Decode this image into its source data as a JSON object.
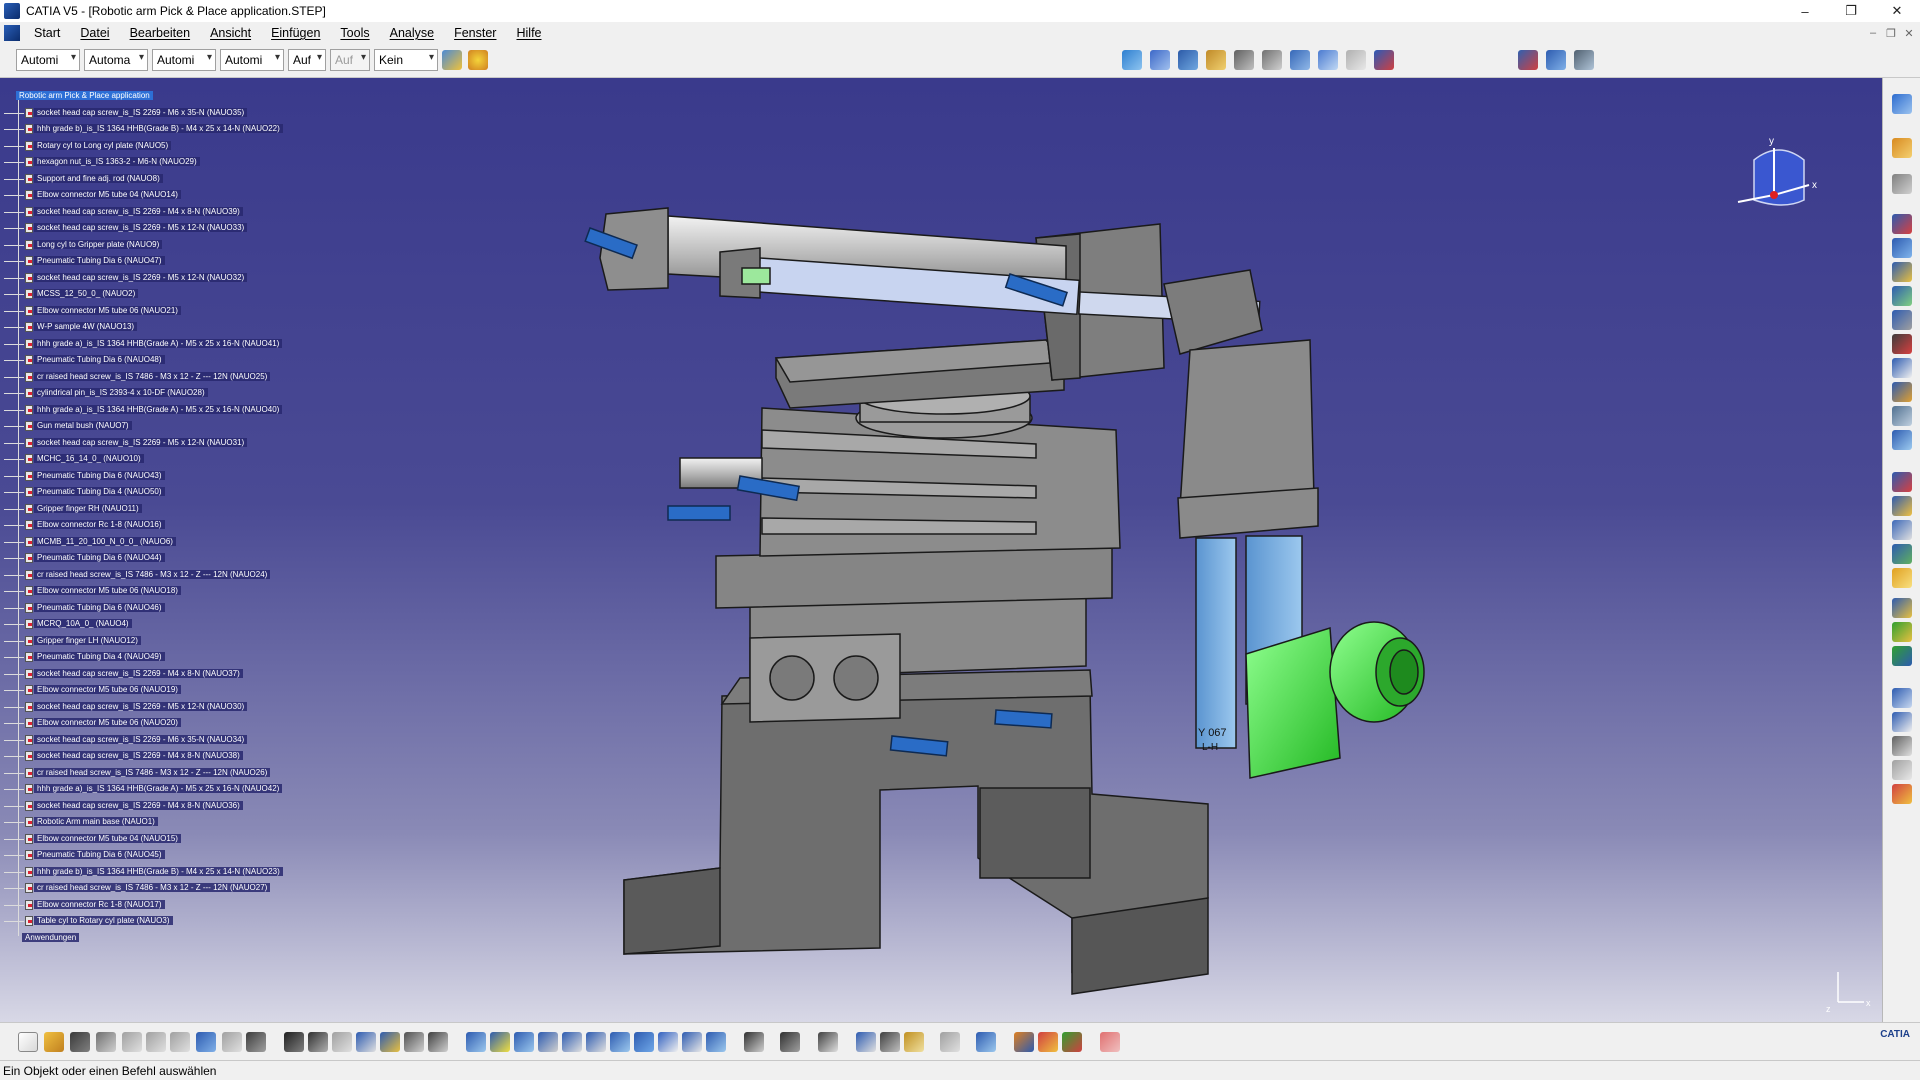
{
  "window": {
    "title": "CATIA V5 - [Robotic arm Pick & Place application.STEP]",
    "controls": [
      "–",
      "❐",
      "✕"
    ]
  },
  "menu": {
    "items": [
      "Start",
      "Datei",
      "Bearbeiten",
      "Ansicht",
      "Einfügen",
      "Tools",
      "Analyse",
      "Fenster",
      "Hilfe"
    ],
    "mdi_controls": [
      "–",
      "❐",
      "✕"
    ]
  },
  "toolbar": {
    "combos": [
      {
        "value": "Automi",
        "disabled": false
      },
      {
        "value": "Automa",
        "disabled": false
      },
      {
        "value": "Automi",
        "disabled": false
      },
      {
        "value": "Automi",
        "disabled": false
      },
      {
        "value": "Auf",
        "disabled": false
      },
      {
        "value": "Auf",
        "disabled": true
      },
      {
        "value": "Kein",
        "disabled": false
      }
    ]
  },
  "tree": {
    "root": "Robotic arm Pick & Place application",
    "nodes": [
      "socket head cap screw_is_IS 2269 - M6 x 35-N (NAUO35)",
      "hhh grade b)_is_IS 1364 HHB(Grade B) - M4 x 25 x 14-N (NAUO22)",
      "Rotary cyl to Long cyl plate (NAUO5)",
      "hexagon nut_is_IS 1363-2 - M6-N (NAUO29)",
      "Support and fine adj. rod (NAUO8)",
      "Elbow connector M5 tube 04 (NAUO14)",
      "socket head cap screw_is_IS 2269 - M4 x 8-N (NAUO39)",
      "socket head cap screw_is_IS 2269 - M5 x 12-N (NAUO33)",
      "Long cyl to Gripper plate (NAUO9)",
      "Pneumatic Tubing Dia 6 (NAUO47)",
      "socket head cap screw_is_IS 2269 - M5 x 12-N (NAUO32)",
      "MCSS_12_50_0_ (NAUO2)",
      "Elbow connector M5 tube 06 (NAUO21)",
      "W-P sample 4W (NAUO13)",
      "hhh grade a)_is_IS 1364 HHB(Grade A) - M5 x 25 x 16-N (NAUO41)",
      "Pneumatic Tubing Dia 6 (NAUO48)",
      "cr raised head screw_is_IS 7486 - M3 x 12 - Z --- 12N (NAUO25)",
      "cylindrical pin_is_IS 2393-4 x 10-DF (NAUO28)",
      "hhh grade a)_is_IS 1364 HHB(Grade A) - M5 x 25 x 16-N (NAUO40)",
      "Gun metal bush (NAUO7)",
      "socket head cap screw_is_IS 2269 - M5 x 12-N (NAUO31)",
      "MCHC_16_14_0_ (NAUO10)",
      "Pneumatic Tubing Dia 6 (NAUO43)",
      "Pneumatic Tubing Dia 4 (NAUO50)",
      "Gripper finger RH (NAUO11)",
      "Elbow connector Rc 1-8 (NAUO16)",
      "MCMB_11_20_100_N_0_0_ (NAUO6)",
      "Pneumatic Tubing Dia 6 (NAUO44)",
      "cr raised head screw_is_IS 7486 - M3 x 12 - Z --- 12N (NAUO24)",
      "Elbow connector M5 tube 06 (NAUO18)",
      "Pneumatic Tubing Dia 6 (NAUO46)",
      "MCRQ_10A_0_ (NAUO4)",
      "Gripper finger LH (NAUO12)",
      "Pneumatic Tubing Dia 4 (NAUO49)",
      "socket head cap screw_is_IS 2269 - M4 x 8-N (NAUO37)",
      "Elbow connector M5 tube 06 (NAUO19)",
      "socket head cap screw_is_IS 2269 - M5 x 12-N (NAUO30)",
      "Elbow connector M5 tube 06 (NAUO20)",
      "socket head cap screw_is_IS 2269 - M6 x 35-N (NAUO34)",
      "socket head cap screw_is_IS 2269 - M4 x 8-N (NAUO38)",
      "cr raised head screw_is_IS 7486 - M3 x 12 - Z --- 12N (NAUO26)",
      "hhh grade a)_is_IS 1364 HHB(Grade A) - M5 x 25 x 16-N (NAUO42)",
      "socket head cap screw_is_IS 2269 - M4 x 8-N (NAUO36)",
      "Robotic Arm main base (NAUO1)",
      "Elbow connector M5 tube 04 (NAUO15)",
      "Pneumatic Tubing Dia 6 (NAUO45)",
      "hhh grade b)_is_IS 1364 HHB(Grade B) - M4 x 25 x 14-N (NAUO23)",
      "cr raised head screw_is_IS 7486 - M3 x 12 - Z --- 12N (NAUO27)",
      "Elbow connector Rc 1-8 (NAUO17)",
      "Table cyl to Rotary cyl plate (NAUO3)"
    ],
    "applications": "Anwendungen"
  },
  "compass": {
    "axis_x": "x",
    "axis_y": "y",
    "axis_z": "z"
  },
  "model": {
    "engraving": "Y 067",
    "engraving2": "L-H"
  },
  "status": {
    "text": "Ein Objekt oder einen Befehl auswählen"
  },
  "brand": {
    "logo": "CATIA"
  },
  "colors": {
    "viewport_top": "#3a3a8c",
    "viewport_bottom": "#d8d8e6",
    "part_grey": "#8a8a8a",
    "gripper_blue": "#6aa6d6",
    "workpiece_green": "#4be04b",
    "selection_blue": "#2d6fd6"
  }
}
